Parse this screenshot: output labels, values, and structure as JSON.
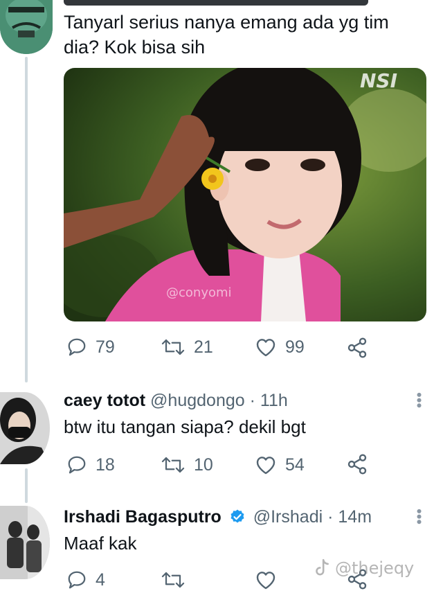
{
  "tweet_main": {
    "text": "Tanyarl serius nanya emang ada yg tim dia? Kok bisa sih",
    "photo_overlays": {
      "channel_logo": "NSI",
      "watermark": "@conyomi"
    },
    "actions": {
      "replies": "79",
      "retweets": "21",
      "likes": "99"
    }
  },
  "reply_1": {
    "name": "caey totot",
    "handle": "@hugdongo",
    "sep": "·",
    "time": "11h",
    "text": "btw itu tangan siapa? dekil bgt",
    "actions": {
      "replies": "18",
      "retweets": "10",
      "likes": "54"
    }
  },
  "reply_2": {
    "name": "Irshadi Bagasputro",
    "handle": "@Irshadi",
    "sep": "·",
    "time": "14m",
    "text": "Maaf kak",
    "verified": true,
    "actions": {
      "replies": "4"
    }
  },
  "tiktok_watermark": "@thejeqy",
  "colors": {
    "text": "#0f1419",
    "muted": "#536471",
    "verified": "#1d9bf0",
    "line": "#cfd9de"
  },
  "icons": [
    "reply-icon",
    "retweet-icon",
    "like-icon",
    "share-icon",
    "more-icon",
    "verified-icon",
    "tiktok-icon"
  ]
}
